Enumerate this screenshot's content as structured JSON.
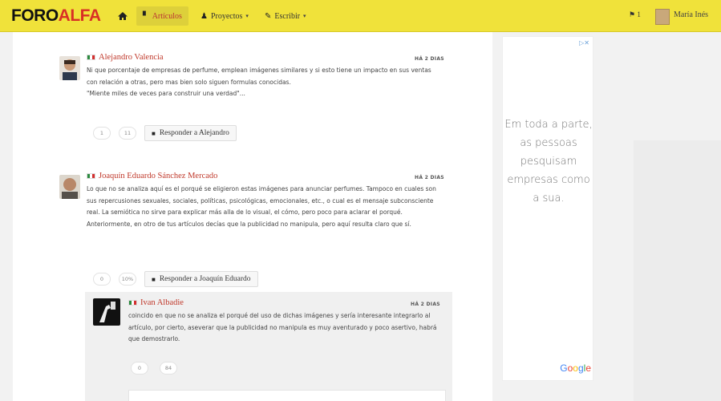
{
  "topbar": {
    "logo_part1": "FORO",
    "logo_part2": "ALFA",
    "nav": [
      {
        "label": "Artículos",
        "icon": "document-icon",
        "active": true
      },
      {
        "label": "Proyectos",
        "icon": "user-icon",
        "caret": true
      },
      {
        "label": "Escribir",
        "icon": "pencil-icon",
        "caret": true
      }
    ],
    "flag_count": "1",
    "user_name": "María Inés"
  },
  "ad": {
    "close": "▷✕",
    "text": "Em toda a parte, as pessoas pesquisam empresas como a sua.",
    "brand": "Google"
  },
  "comments": [
    {
      "author": "Alejandro Valencia",
      "date": "HÁ 2 DIAS",
      "body": "Ni que porcentaje de empresas de perfume, emplean imágenes similares y si esto tiene un impacto en sus ventas con relación a otras, pero mas bien solo siguen formulas conocidas.\n\"Miente miles de veces para construir una verdad\"...",
      "votes_up": "1",
      "votes_down": "11",
      "reply_label": "Responder a Alejandro"
    },
    {
      "author": "Joaquín Eduardo Sánchez Mercado",
      "date": "HÁ 2 DIAS",
      "body": "Lo que no se analiza aquí es el porqué se eligieron estas imágenes para anunciar perfumes. Tampoco en cuales son sus repercusiones sexuales, sociales, políticas, psicológicas, emocionales, etc., o cual es el mensaje subconsciente real. La semiótica no sirve para explicar más alla de lo visual, el cómo, pero poco para aclarar el porqué. Anteriormente, en otro de tus artículos decías que la publicidad no manipula, pero aquí resulta claro que sí.",
      "votes_up": "0",
      "votes_down": "10%",
      "reply_label": "Responder a Joaquín Eduardo"
    },
    {
      "author": "Ivan Albadie",
      "date": "HÁ 2 DIAS",
      "body": "coincido en que no se analiza el porqué del uso de dichas imágenes y sería interesante integrarlo al artículo, por cierto, aseverar que la publicidad no manipula es muy aventurado y poco asertivo, habrá que demostrarlo.",
      "votes_up": "0",
      "votes_down": "84"
    }
  ]
}
